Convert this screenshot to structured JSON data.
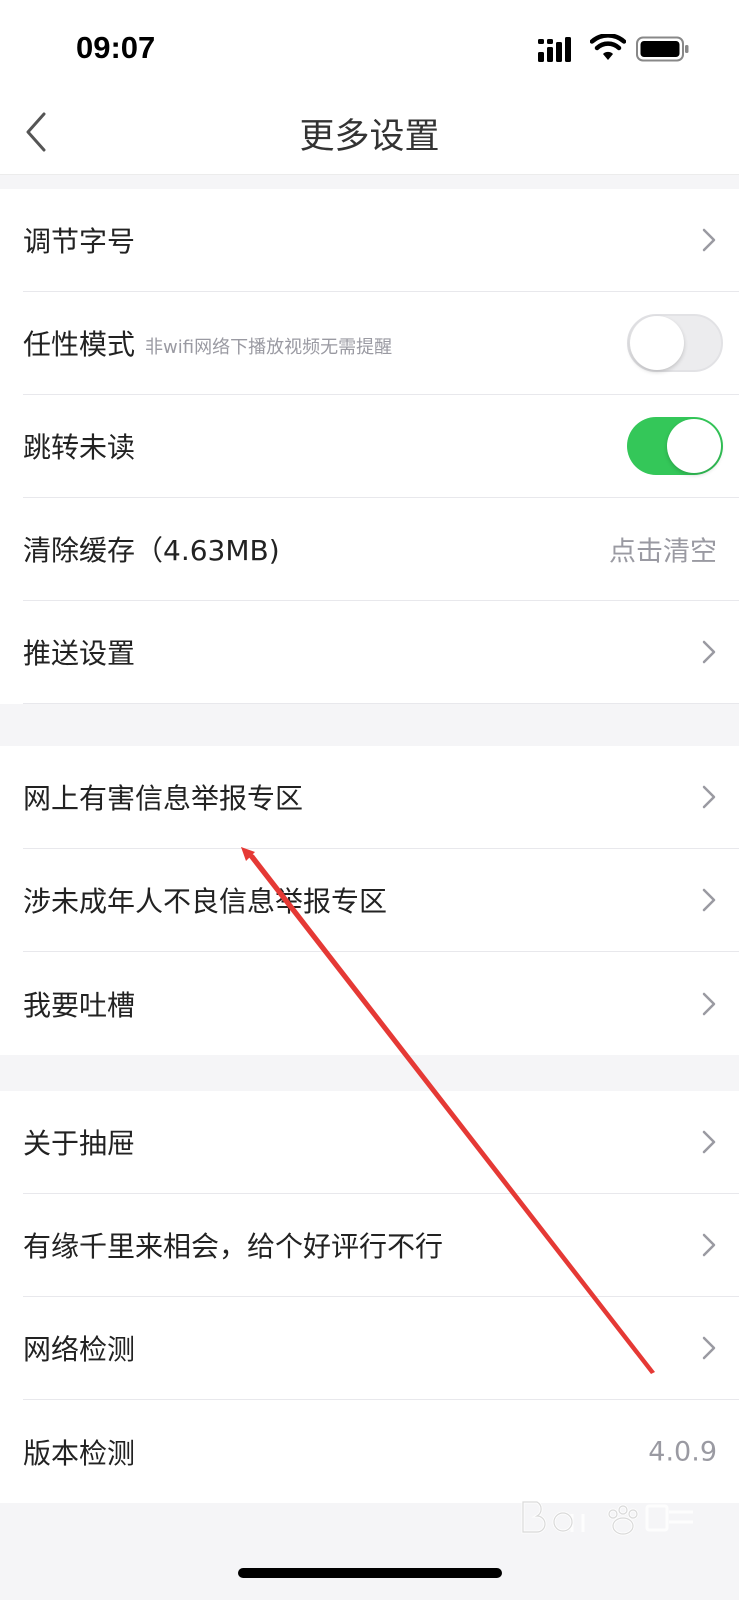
{
  "status_bar": {
    "time": "09:07"
  },
  "nav": {
    "title": "更多设置"
  },
  "group1": {
    "font_size": "调节字号",
    "willful_mode": {
      "label": "任性模式",
      "hint": "非wifi网络下播放视频无需提醒",
      "enabled": false
    },
    "jump_unread": {
      "label": "跳转未读",
      "enabled": true
    },
    "clear_cache": {
      "label": "清除缓存（4.63MB)",
      "action": "点击清空"
    },
    "push_settings": "推送设置"
  },
  "group2": {
    "harmful_info_report": "网上有害信息举报专区",
    "minor_info_report": "涉未成年人不良信息举报专区",
    "feedback": "我要吐槽"
  },
  "group3": {
    "about": "关于抽屉",
    "rate_us": "有缘千里来相会，给个好评行不行",
    "network_check": "网络检测",
    "version_check": {
      "label": "版本检测",
      "version": "4.0.9"
    }
  },
  "colors": {
    "toggle_on": "#34c759",
    "annotation_arrow": "#e53935"
  },
  "icons": [
    "signal-icon",
    "wifi-icon",
    "battery-icon",
    "back-chevron-icon",
    "chevron-right-icon"
  ]
}
